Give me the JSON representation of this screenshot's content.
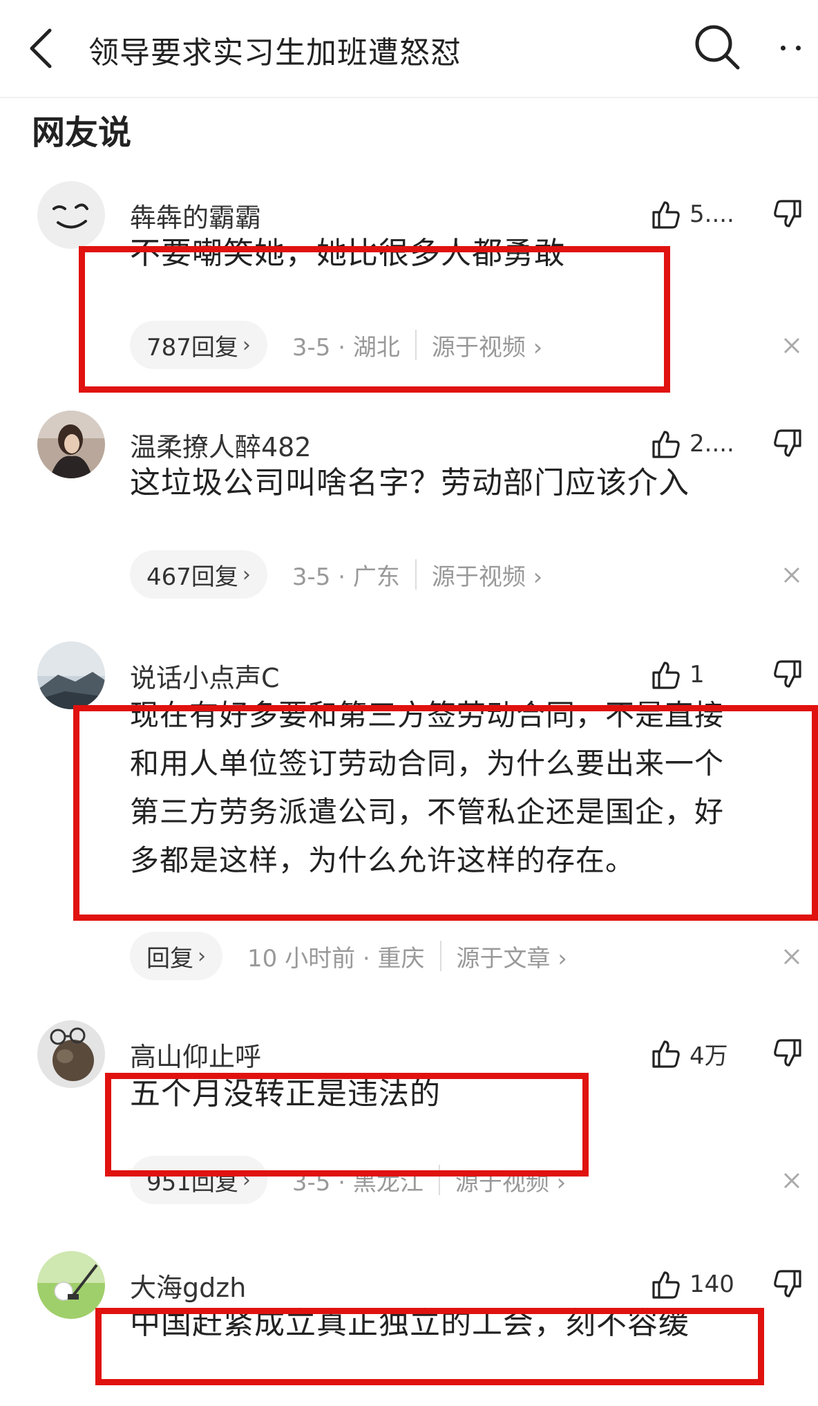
{
  "header": {
    "title": "领导要求实习生加班遭怒怼"
  },
  "section": {
    "title": "网友说"
  },
  "comments": [
    {
      "username": "犇犇的霸霸",
      "likes": "5....",
      "text": "不要嘲笑她，她比很多人都勇敢",
      "replies": "787回复",
      "meta": "3-5 · 湖北",
      "source": "源于视频"
    },
    {
      "username": "温柔撩人醉482",
      "likes": "2....",
      "text": "这垃圾公司叫啥名字？劳动部门应该介入",
      "replies": "467回复",
      "meta": "3-5 · 广东",
      "source": "源于视频"
    },
    {
      "username": "说话小点声C",
      "likes": "1",
      "text_lines": [
        "现在有好多要和第三方签劳动合同，不是直接",
        "和用人单位签订劳动合同，为什么要出来一个",
        "第三方劳务派遣公司，不管私企还是国企，好",
        "多都是这样，为什么允许这样的存在。"
      ],
      "replies": "回复",
      "meta": "10 小时前 · 重庆",
      "source": "源于文章"
    },
    {
      "username": "高山仰止呼",
      "likes": "4万",
      "text": "五个月没转正是违法的",
      "replies": "951回复",
      "meta": "3-5 · 黑龙江",
      "source": "源于视频"
    },
    {
      "username": "大海gdzh",
      "likes": "140",
      "text": "中国赶紧成立真正独立的工会，刻不容缓"
    }
  ],
  "icons": {
    "back": "chevron-left-icon",
    "search": "search-icon",
    "more": "more-icon",
    "like": "thumbs-up-icon",
    "dislike": "thumbs-down-icon",
    "close": "close-icon"
  },
  "colors": {
    "highlight": "#e0120f",
    "meta": "#999999",
    "pill": "#f4f4f4"
  }
}
